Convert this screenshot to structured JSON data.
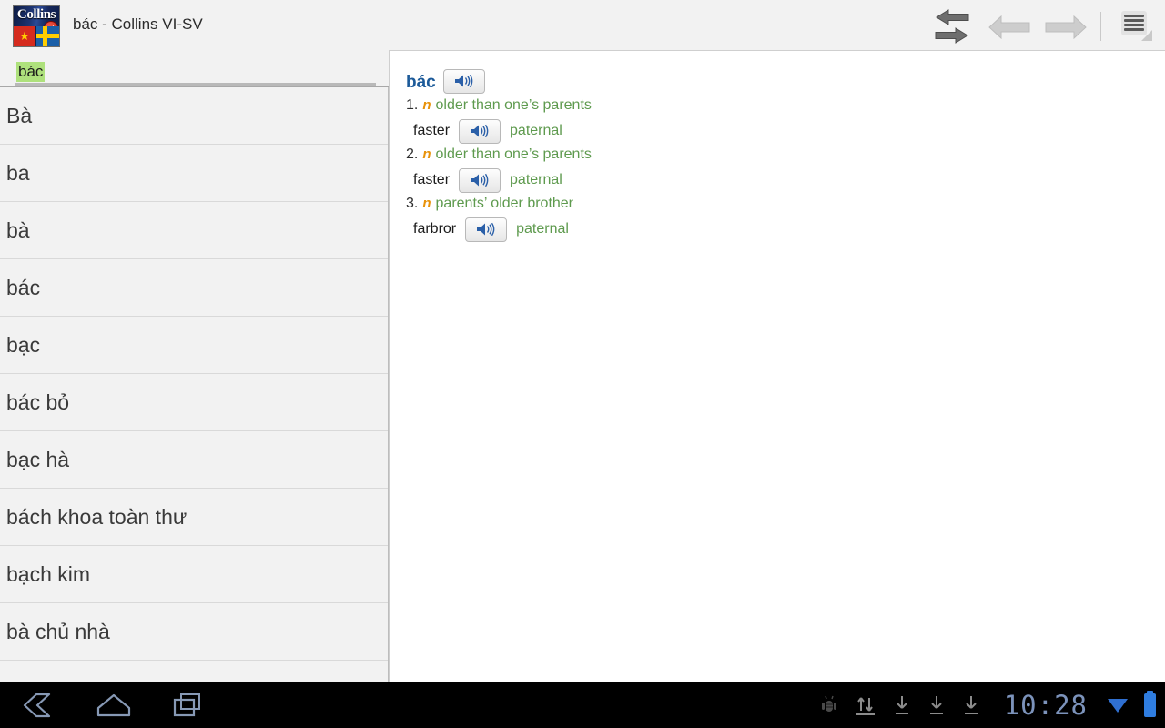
{
  "window": {
    "title": "bác - Collins VI-SV",
    "logo_word": "Collins",
    "logo_flag_left": "vietnam-flag",
    "logo_flag_right": "sweden-flag"
  },
  "toolbar": {
    "swap_label": "swap-languages",
    "back_label": "back",
    "forward_label": "forward",
    "menu_label": "menu"
  },
  "search": {
    "value": "bác",
    "placeholder": "bác"
  },
  "wordlist": {
    "items": [
      {
        "label": "Bà"
      },
      {
        "label": "ba"
      },
      {
        "label": "bà"
      },
      {
        "label": "bác"
      },
      {
        "label": "bạc"
      },
      {
        "label": "bác bỏ"
      },
      {
        "label": "bạc hà"
      },
      {
        "label": "bách khoa toàn thư"
      },
      {
        "label": "bạch kim"
      },
      {
        "label": "bà chủ nhà"
      }
    ]
  },
  "entry": {
    "headword": "bác",
    "audio_icon": "speaker-icon",
    "senses": [
      {
        "number": "1.",
        "pos": "n",
        "gloss": "older than one’s parents",
        "translation": "faster",
        "tag": "paternal"
      },
      {
        "number": "2.",
        "pos": "n",
        "gloss": "older than one’s parents",
        "translation": "faster",
        "tag": "paternal"
      },
      {
        "number": "3.",
        "pos": "n",
        "gloss": "parents’ older brother",
        "translation": "farbror",
        "tag": "paternal"
      }
    ]
  },
  "navbar": {
    "back_label": "back",
    "home_label": "home",
    "recents_label": "recent-apps"
  },
  "statusbar": {
    "debug_label": "android-debug",
    "usb_label": "usb-transfer",
    "download_label": "download",
    "download_count": 3,
    "time": "10:28",
    "wifi_label": "wifi",
    "battery_label": "battery"
  },
  "colors": {
    "accent_headword": "#1c5a99",
    "gloss_green": "#5e9a4e",
    "pos_orange": "#e8920a",
    "search_highlight": "#aee17c",
    "panel_bg": "#f2f2f2"
  }
}
